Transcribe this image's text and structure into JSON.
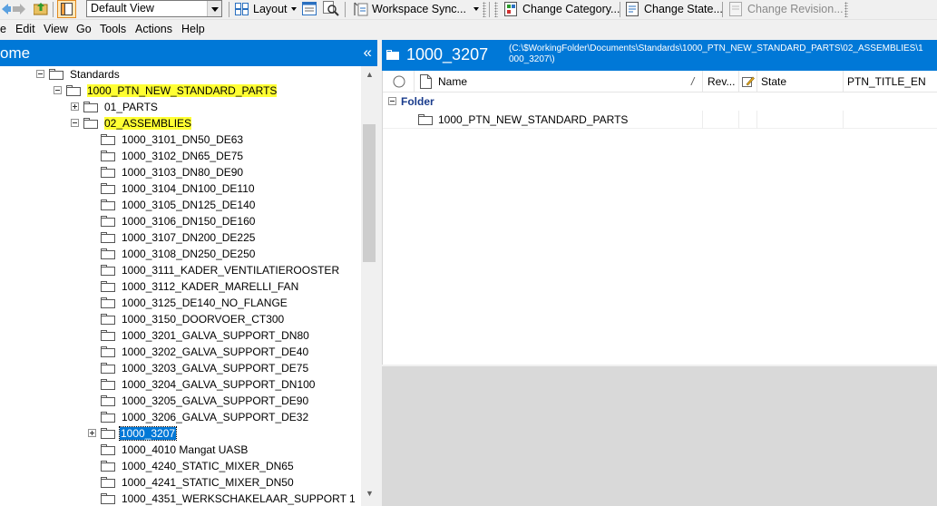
{
  "toolbar": {
    "view_select": "Default View",
    "layout": "Layout",
    "workspace_sync": "Workspace Sync...",
    "change_category": "Change Category...",
    "change_state": "Change State...",
    "change_revision": "Change Revision..."
  },
  "menu": [
    "e",
    "Edit",
    "View",
    "Go",
    "Tools",
    "Actions",
    "Help"
  ],
  "left_pane": {
    "title": "ome",
    "collapse_glyph": "«"
  },
  "tree": [
    {
      "label": "Standards",
      "toggle": "minus"
    },
    {
      "label": "1000_PTN_NEW_STANDARD_PARTS",
      "toggle": "minus"
    },
    {
      "label": "01_PARTS",
      "toggle": "plus"
    },
    {
      "label": "02_ASSEMBLIES",
      "toggle": "minus"
    },
    {
      "label": "1000_3101_DN50_DE63"
    },
    {
      "label": "1000_3102_DN65_DE75"
    },
    {
      "label": "1000_3103_DN80_DE90"
    },
    {
      "label": "1000_3104_DN100_DE110"
    },
    {
      "label": "1000_3105_DN125_DE140"
    },
    {
      "label": "1000_3106_DN150_DE160"
    },
    {
      "label": "1000_3107_DN200_DE225"
    },
    {
      "label": "1000_3108_DN250_DE250"
    },
    {
      "label": "1000_3111_KADER_VENTILATIEROOSTER"
    },
    {
      "label": "1000_3112_KADER_MARELLI_FAN"
    },
    {
      "label": "1000_3125_DE140_NO_FLANGE"
    },
    {
      "label": "1000_3150_DOORVOER_CT300"
    },
    {
      "label": "1000_3201_GALVA_SUPPORT_DN80"
    },
    {
      "label": "1000_3202_GALVA_SUPPORT_DE40"
    },
    {
      "label": "1000_3203_GALVA_SUPPORT_DE75"
    },
    {
      "label": "1000_3204_GALVA_SUPPORT_DN100"
    },
    {
      "label": "1000_3205_GALVA_SUPPORT_DE90"
    },
    {
      "label": "1000_3206_GALVA_SUPPORT_DE32"
    },
    {
      "label": "1000_3207",
      "toggle": "plus",
      "selected": true
    },
    {
      "label": "1000_4010 Mangat UASB"
    },
    {
      "label": "1000_4240_STATIC_MIXER_DN65"
    },
    {
      "label": "1000_4241_STATIC_MIXER_DN50"
    },
    {
      "label": "1000_4351_WERKSCHAKELAAR_SUPPORT 1"
    }
  ],
  "right_pane": {
    "title": "1000_3207",
    "path_line1": "(C:\\$WorkingFolder\\Documents\\Standards\\1000_PTN_NEW_STANDARD_PARTS\\02_ASSEMBLIES\\1",
    "path_line2": "000_3207\\)"
  },
  "columns": {
    "name": "Name",
    "sort_glyph": "/",
    "revision": "Rev...",
    "state": "State",
    "title_en": "PTN_TITLE_EN"
  },
  "group": {
    "label": "Folder"
  },
  "rows": [
    {
      "name": "1000_PTN_NEW_STANDARD_PARTS"
    }
  ],
  "colors": {
    "accent": "#0078d7",
    "highlight": "#ffff33",
    "group_text": "#1a3c8c"
  }
}
